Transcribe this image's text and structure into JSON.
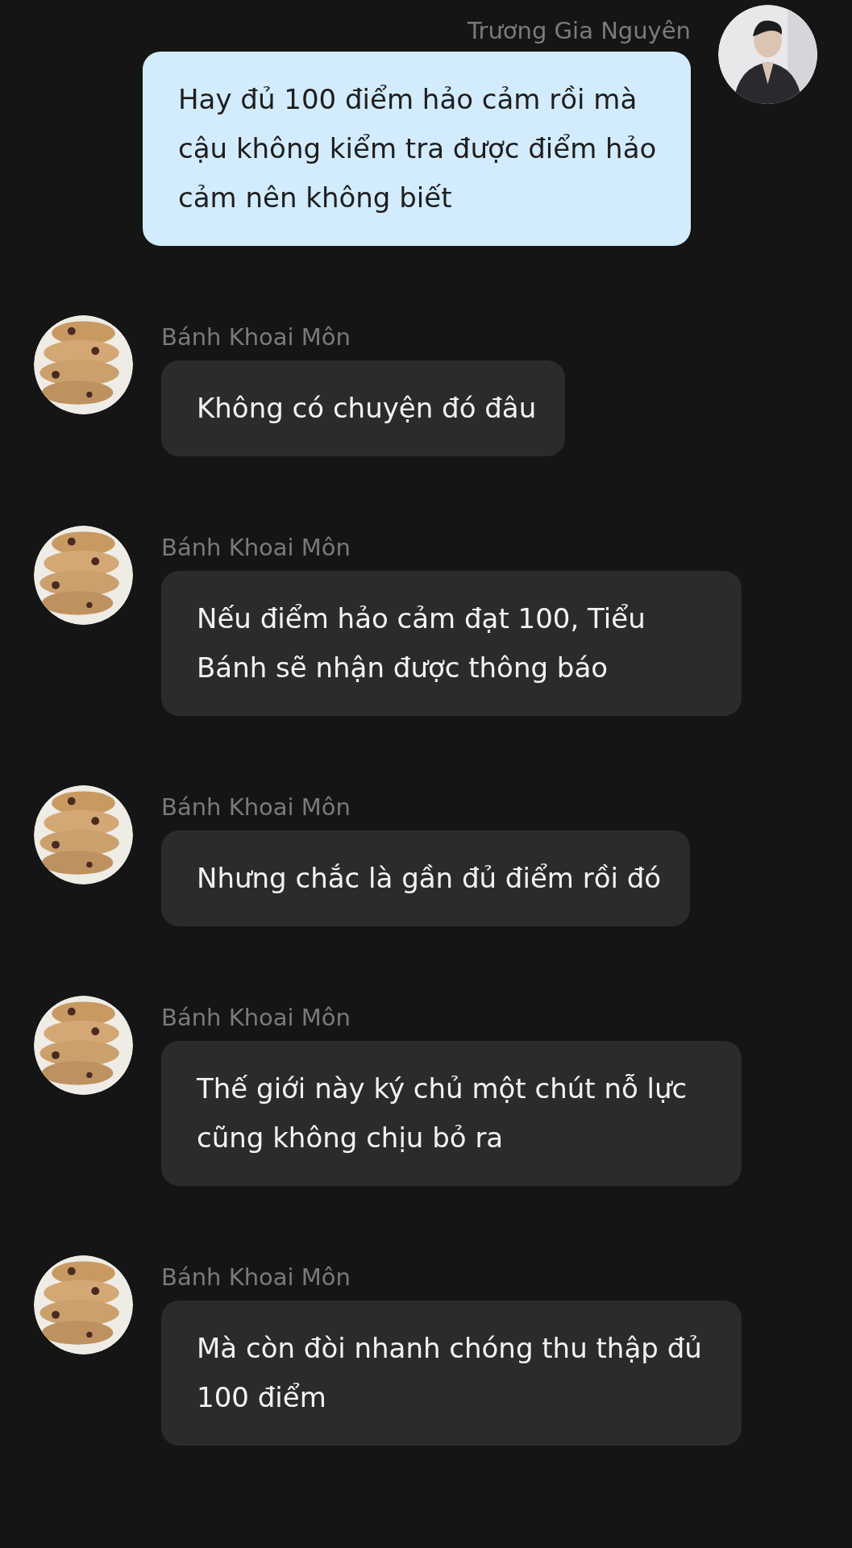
{
  "messages": [
    {
      "kind": "sent",
      "sender": "Trương Gia Nguyên",
      "text": "Hay đủ 100 điểm hảo cảm rồi mà cậu không kiểm tra được điểm hảo cảm nên không biết"
    },
    {
      "kind": "received",
      "sender": "Bánh Khoai Môn",
      "text": "Không có chuyện đó đâu"
    },
    {
      "kind": "received",
      "sender": "Bánh Khoai Môn",
      "text": "Nếu điểm hảo cảm đạt 100, Tiểu Bánh sẽ nhận được thông báo"
    },
    {
      "kind": "received",
      "sender": "Bánh Khoai Môn",
      "text": "Nhưng chắc là gần đủ điểm rồi đó"
    },
    {
      "kind": "received",
      "sender": "Bánh Khoai Môn",
      "text": "Thế giới này ký chủ một chút nỗ lực cũng không chịu bỏ ra"
    },
    {
      "kind": "received",
      "sender": "Bánh Khoai Môn",
      "text": "Mà còn đòi nhanh chóng thu thập đủ 100 điểm"
    }
  ]
}
